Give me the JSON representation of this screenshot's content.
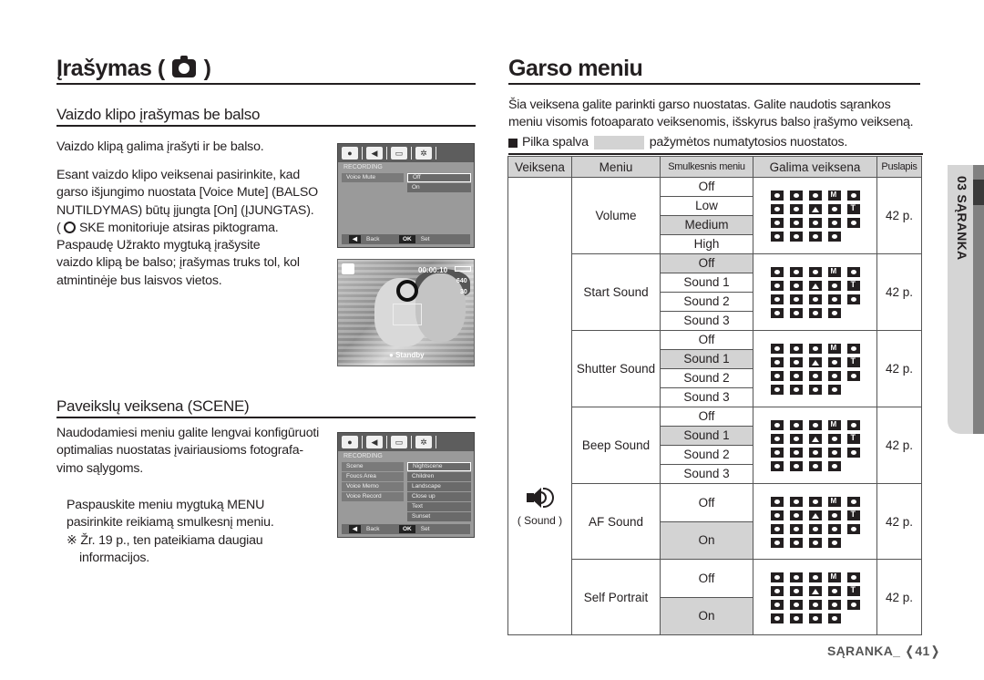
{
  "left": {
    "title": "Įrašymas (",
    "title_close": ")",
    "section1": {
      "heading": "Vaizdo klipo įrašymas be balso",
      "intro": "Vaizdo klipą galima įrašyti ir be balso.",
      "lines": [
        "Esant vaizdo klipo veiksenai pasirinkite, kad",
        "garso išjungimo nuostata [Voice Mute] (BALSO",
        "NUTILDYMAS) būtų įjungta [On] (ĮJUNGTAS).",
        "( ) SKE monitoriuje atsiras piktograma.",
        "Paspaudę Užrakto mygtuką įrašysite",
        "vaizdo klipą be balso; įrašymas truks tol, kol",
        "atmintinėje bus laisvos vietos."
      ],
      "screen": {
        "header": "RECORDING",
        "menu_item": "Voice Mute",
        "options": [
          "Off",
          "On"
        ],
        "back": "Back",
        "ok": "OK",
        "set": "Set"
      },
      "preview": {
        "timer": "00:00:10",
        "resolution": "640",
        "fps": "30",
        "status": "Standby"
      }
    },
    "section2": {
      "heading": "Paveikslų veiksena (SCENE)",
      "lines": [
        "Naudodamiesi meniu galite lengvai konfigūruoti",
        "optimalias nuostatas įvairiausioms fotografa-",
        "vimo sąlygoms."
      ],
      "steps": [
        "Paspauskite meniu mygtuką MENU",
        "pasirinkite reikiamą smulkesnį meniu.",
        "※ Žr. 19 p., ten pateikiama daugiau",
        "informacijos."
      ],
      "screen": {
        "header": "RECORDING",
        "menu_items": [
          "Scene",
          "Foucs Area",
          "Voice Memo",
          "Voice Record"
        ],
        "options": [
          "Nightscene",
          "Children",
          "Landscape",
          "Close up",
          "Text",
          "Sunset"
        ],
        "back": "Back",
        "ok": "OK",
        "set": "Set"
      }
    }
  },
  "right": {
    "title": "Garso meniu",
    "intro_lines": [
      "Šia veiksena galite parinkti garso nuostatas. Galite naudotis sąrankos",
      "meniu visomis fotoaparato veiksenomis, išskyrus balso įrašymo veikseną."
    ],
    "legend_prefix": "Pilka spalva",
    "legend_suffix": "pažymėtos numatytosios nuostatos.",
    "table": {
      "headers": [
        "Veiksena",
        "Meniu",
        "Smulkesnis meniu",
        "Galima veiksena",
        "Puslapis"
      ],
      "mode_label": "( Sound )",
      "rows": [
        {
          "menu": "Volume",
          "options": [
            "Off",
            "Low",
            "Medium",
            "High"
          ],
          "default_index": 2,
          "page": "42 p."
        },
        {
          "menu": "Start Sound",
          "options": [
            "Off",
            "Sound 1",
            "Sound 2",
            "Sound 3"
          ],
          "default_index": 0,
          "page": "42 p."
        },
        {
          "menu": "Shutter Sound",
          "options": [
            "Off",
            "Sound 1",
            "Sound 2",
            "Sound 3"
          ],
          "default_index": 1,
          "page": "42 p."
        },
        {
          "menu": "Beep Sound",
          "options": [
            "Off",
            "Sound 1",
            "Sound 2",
            "Sound 3"
          ],
          "default_index": 1,
          "page": "42 p."
        },
        {
          "menu": "AF Sound",
          "options": [
            "Off",
            "On"
          ],
          "default_index": 1,
          "page": "42 p."
        },
        {
          "menu": "Self Portrait",
          "options": [
            "Off",
            "On"
          ],
          "default_index": 1,
          "page": "42 p."
        }
      ],
      "mode_icons": [
        "auto",
        "program",
        "dis",
        "manual",
        "night",
        "portrait-beauty",
        "children",
        "landscape",
        "close-up",
        "text",
        "sunset",
        "dawn",
        "backlight",
        "firework",
        "beach-snow",
        "self-shot",
        "food",
        "cafe",
        "movie"
      ]
    }
  },
  "side_tab": "03 SĄRANKA",
  "footer": {
    "section": "SĄRANKA_",
    "page": "41"
  }
}
